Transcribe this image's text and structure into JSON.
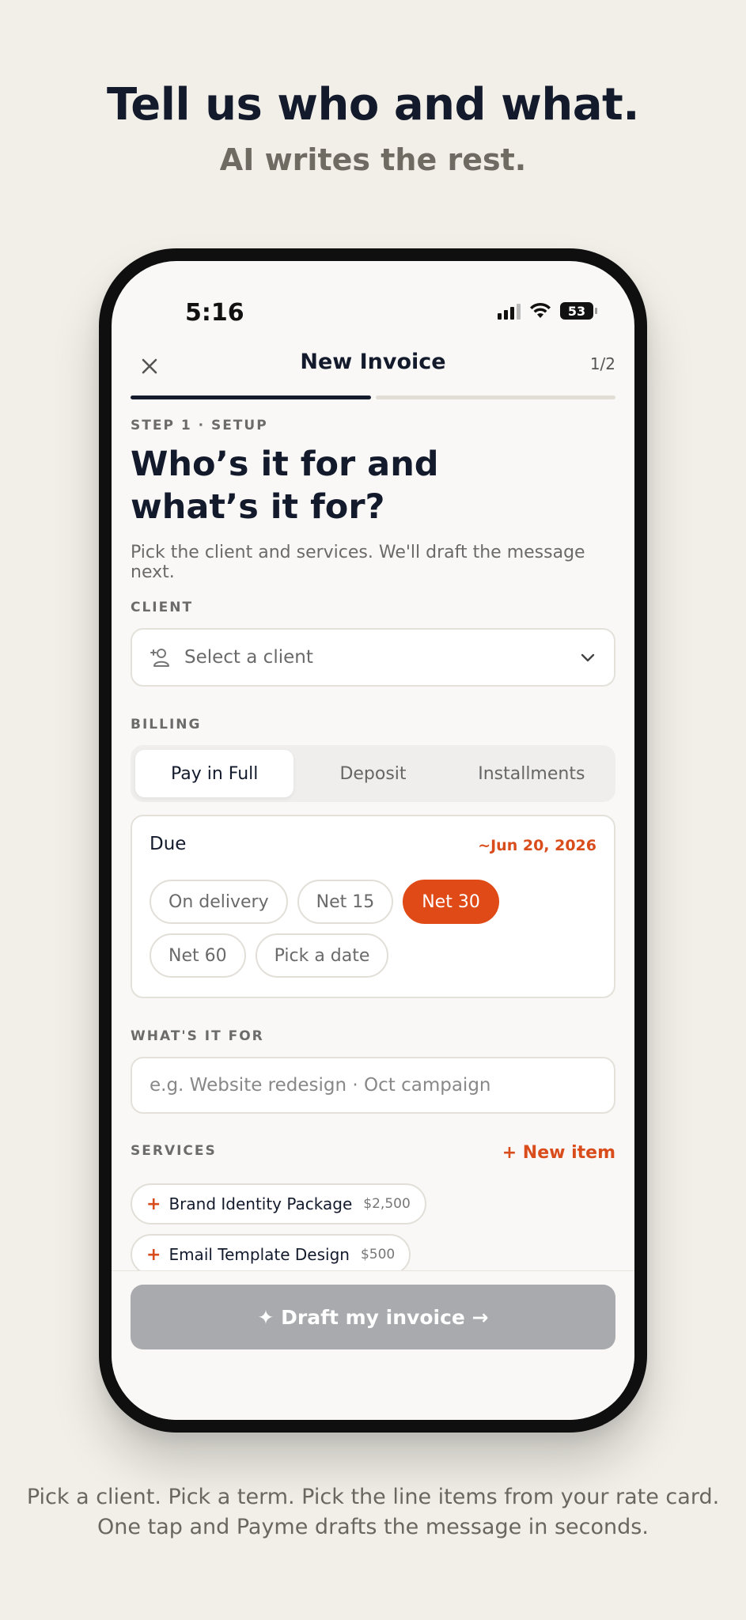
{
  "hero": {
    "title": "Tell us who and what.",
    "subtitle": "AI writes the rest."
  },
  "status_bar": {
    "time": "5:16",
    "battery": "53"
  },
  "nav": {
    "title": "New Invoice",
    "step": "1/2",
    "progress": 0.5
  },
  "step": {
    "label": "STEP 1 · SETUP",
    "heading_line1": "Who’s it for and",
    "heading_line2": "what’s it for?",
    "description": "Pick the client and services. We'll draft the message next."
  },
  "client": {
    "label": "CLIENT",
    "placeholder": "Select a client"
  },
  "billing": {
    "label": "BILLING",
    "options": [
      "Pay in Full",
      "Deposit",
      "Installments"
    ],
    "selected": "Pay in Full"
  },
  "due": {
    "title": "Due",
    "date": "~Jun 20, 2026",
    "chips": [
      "On delivery",
      "Net 15",
      "Net 30",
      "Net 60",
      "Pick a date"
    ],
    "selected": "Net 30"
  },
  "what": {
    "label": "WHAT'S IT FOR",
    "placeholder": "e.g. Website redesign · Oct campaign"
  },
  "services": {
    "label": "SERVICES",
    "new_item": "+ New item",
    "items": [
      {
        "name": "Brand Identity Package",
        "price": "$2,500"
      },
      {
        "name": "Email Template Design",
        "price": "$500"
      }
    ]
  },
  "cta": {
    "label": "✦ Draft my invoice →"
  },
  "footer": {
    "line1": "Pick a client. Pick a term. Pick the line items from your rate card.",
    "line2": "One tap and Payme drafts the message in seconds."
  },
  "colors": {
    "accent": "#e04a17",
    "ink": "#131a2c",
    "background": "#f2efe8",
    "cta_disabled": "#a8aaad"
  }
}
